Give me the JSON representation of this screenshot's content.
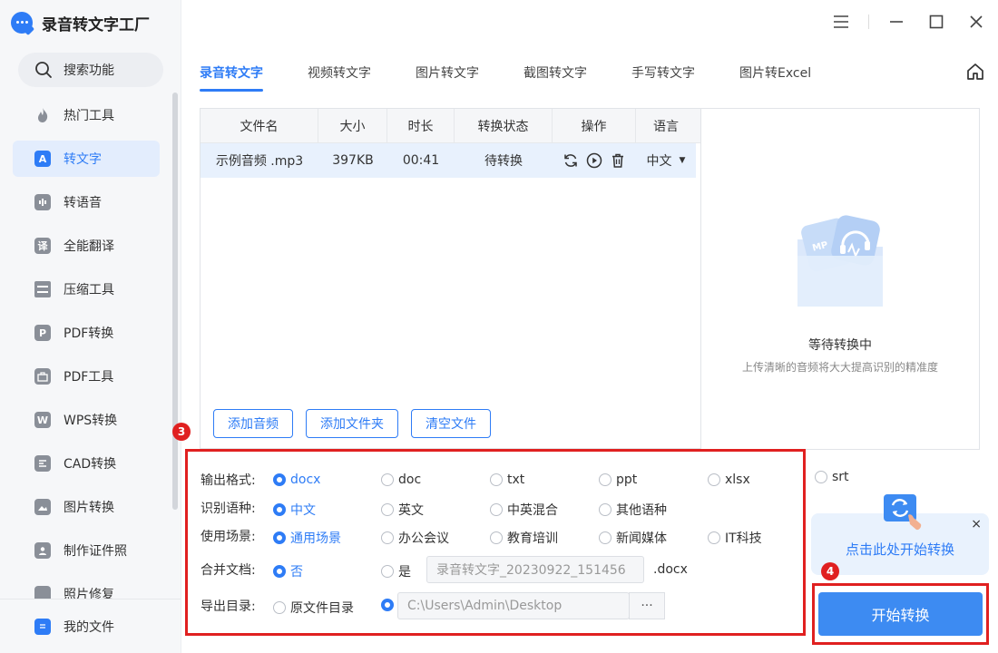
{
  "app": {
    "title": "录音转文字工厂"
  },
  "search": {
    "label": "搜索功能"
  },
  "sidebar": {
    "items": [
      {
        "label": "热门工具",
        "icon": "flame-icon",
        "glyph": ""
      },
      {
        "label": "转文字",
        "icon": "text-a-icon",
        "glyph": "A"
      },
      {
        "label": "转语音",
        "icon": "voice-icon",
        "glyph": ""
      },
      {
        "label": "全能翻译",
        "icon": "translate-icon",
        "glyph": "译"
      },
      {
        "label": "压缩工具",
        "icon": "compress-icon",
        "glyph": ""
      },
      {
        "label": "PDF转换",
        "icon": "pdf-convert-icon",
        "glyph": "P"
      },
      {
        "label": "PDF工具",
        "icon": "toolbox-icon",
        "glyph": ""
      },
      {
        "label": "WPS转换",
        "icon": "wps-icon",
        "glyph": "W"
      },
      {
        "label": "CAD转换",
        "icon": "cad-icon",
        "glyph": ""
      },
      {
        "label": "图片转换",
        "icon": "image-icon",
        "glyph": ""
      },
      {
        "label": "制作证件照",
        "icon": "id-photo-icon",
        "glyph": ""
      },
      {
        "label": "照片修复",
        "icon": "photo-repair-icon",
        "glyph": ""
      }
    ],
    "my_files": "我的文件"
  },
  "tabs": [
    {
      "label": "录音转文字"
    },
    {
      "label": "视频转文字"
    },
    {
      "label": "图片转文字"
    },
    {
      "label": "截图转文字"
    },
    {
      "label": "手写转文字"
    },
    {
      "label": "图片转Excel"
    }
  ],
  "table": {
    "headers": [
      "文件名",
      "大小",
      "时长",
      "转换状态",
      "操作",
      "语言"
    ],
    "rows": [
      {
        "name": "示例音频 .mp3",
        "size": "397KB",
        "duration": "00:41",
        "status": "待转换",
        "lang": "中文"
      }
    ]
  },
  "buttons": {
    "add_audio": "添加音频",
    "add_folder": "添加文件夹",
    "clear_files": "清空文件"
  },
  "preview": {
    "icon_text": "MP",
    "title": "等待转换中",
    "subtitle": "上传清晰的音频将大大提高识别的精准度"
  },
  "options": {
    "format_label": "输出格式:",
    "formats": [
      "docx",
      "doc",
      "txt",
      "ppt",
      "xlsx",
      "srt"
    ],
    "lang_label": "识别语种:",
    "langs": [
      "中文",
      "英文",
      "中英混合",
      "其他语种"
    ],
    "scene_label": "使用场景:",
    "scenes": [
      "通用场景",
      "办公会议",
      "教育培训",
      "新闻媒体",
      "IT科技"
    ],
    "merge_label": "合并文档:",
    "merge_no": "否",
    "merge_yes": "是",
    "merge_name": "录音转文字_20230922_151456",
    "merge_ext": ".docx",
    "export_label": "导出目录:",
    "export_source": "原文件目录",
    "export_path": "C:\\Users\\Admin\\Desktop",
    "browse": "···"
  },
  "badges": {
    "options": "3",
    "start": "4"
  },
  "tooltip": {
    "text": "点击此处开始转换",
    "close": "×"
  },
  "start": {
    "label": "开始转换"
  },
  "colors": {
    "accent": "#2e7cf6",
    "highlight": "#e02020",
    "selected_row": "#e8f1fd"
  }
}
